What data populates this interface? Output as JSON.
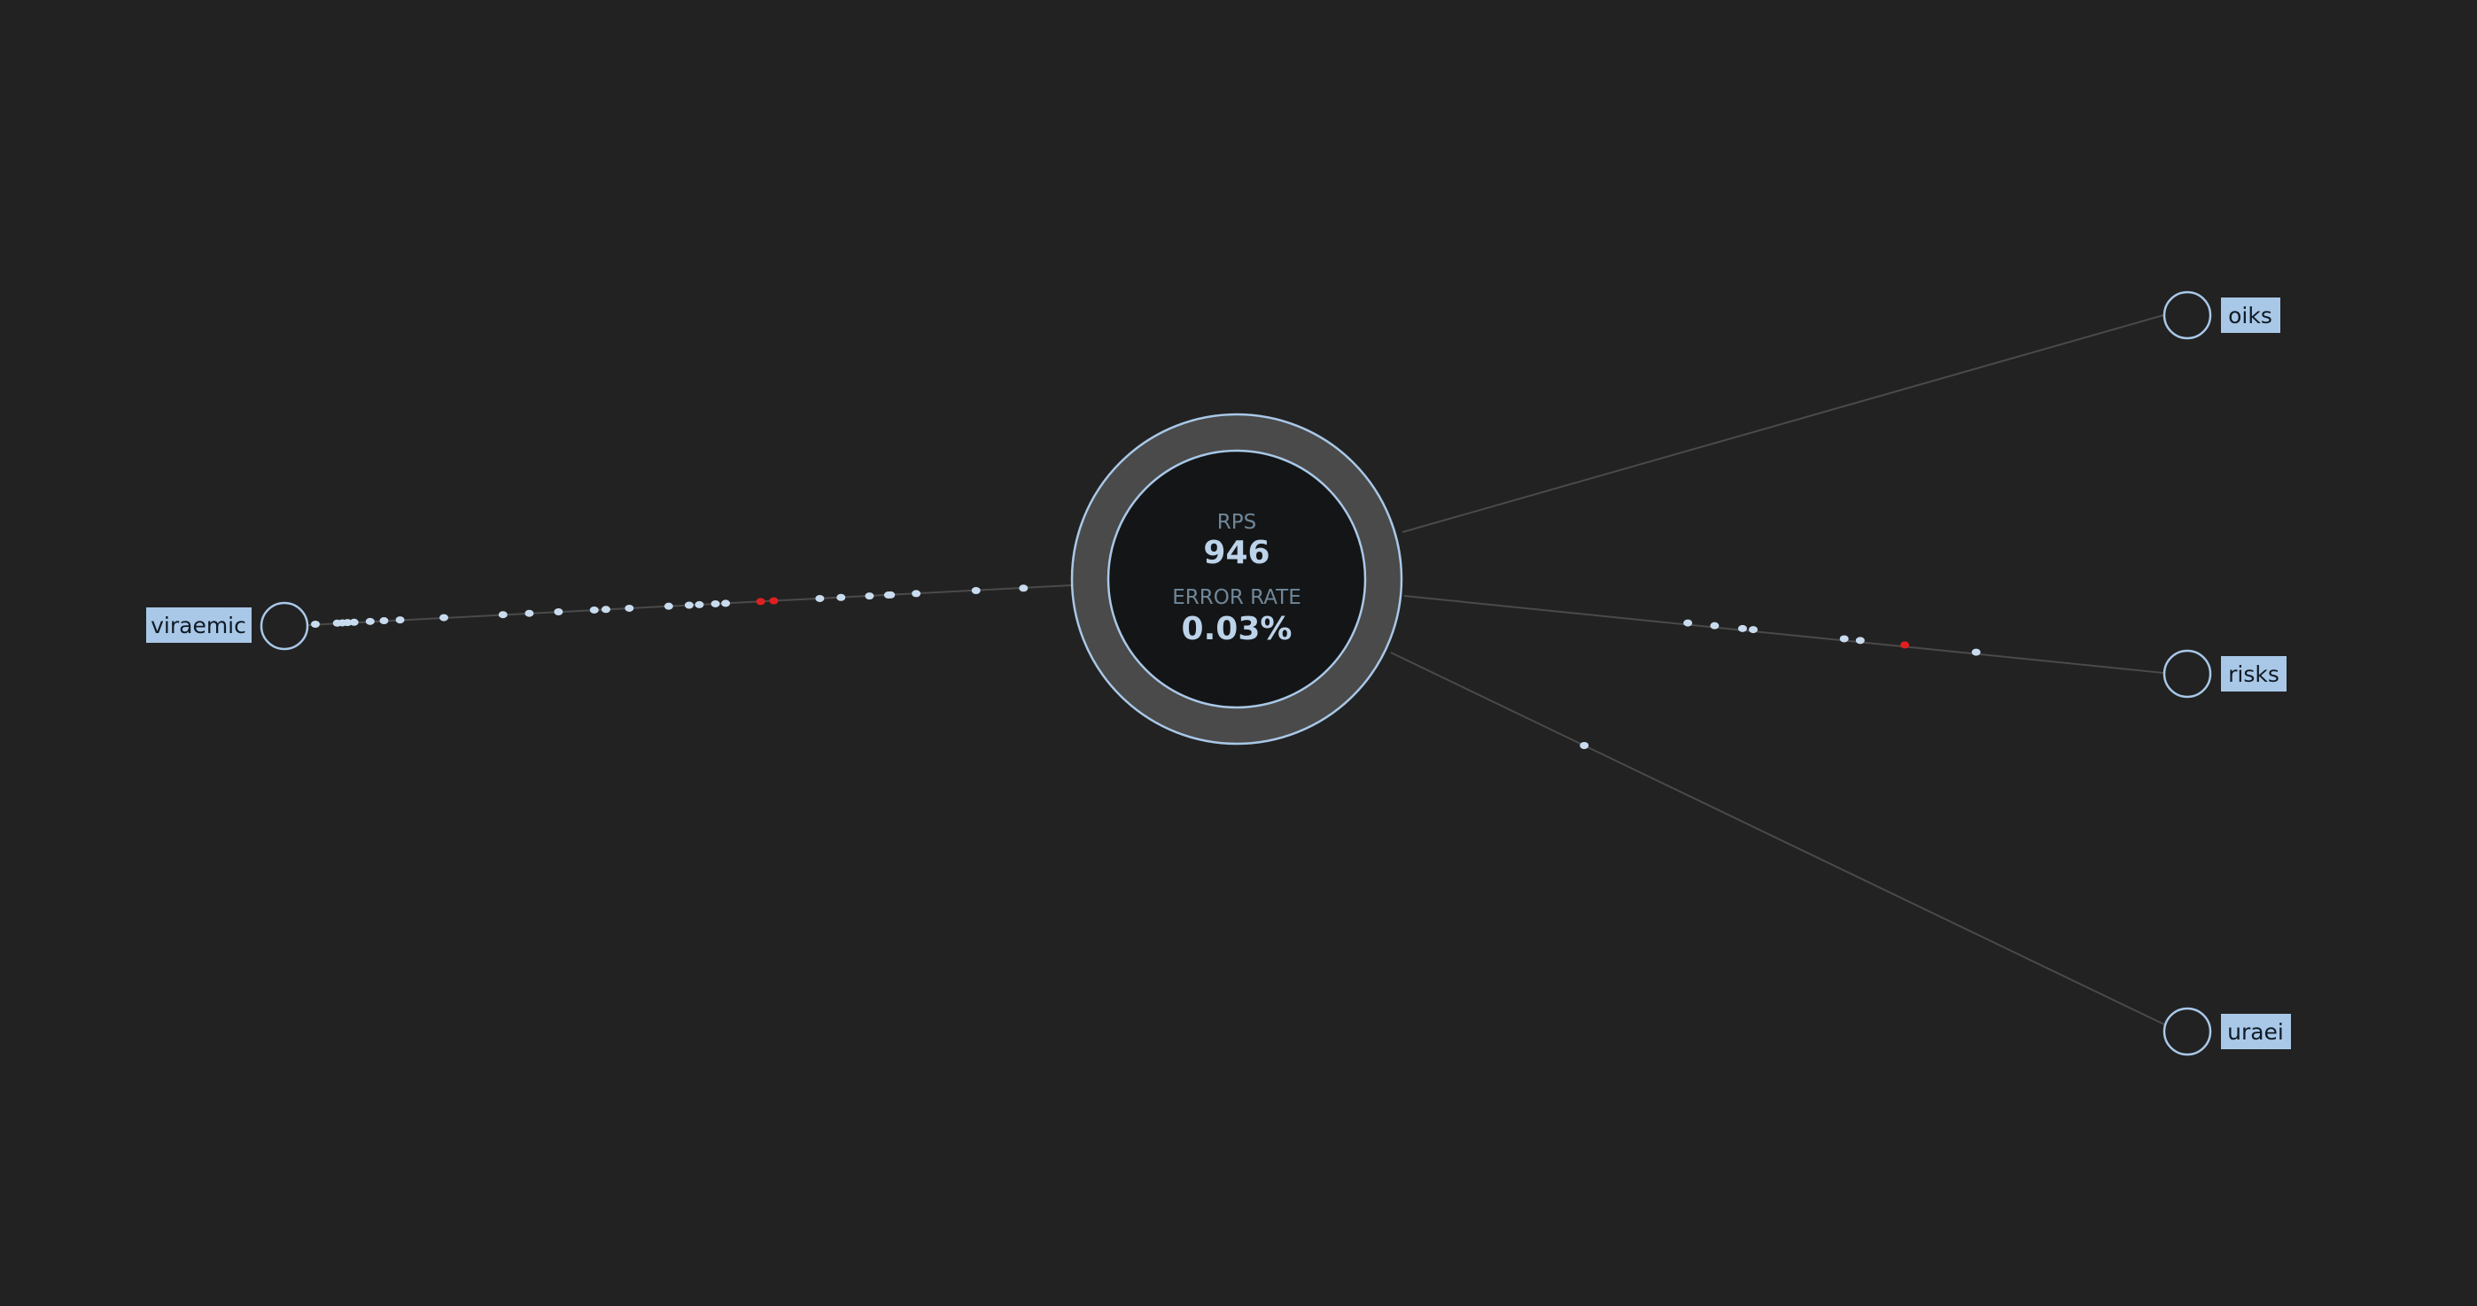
{
  "colors": {
    "background": "#222222",
    "accent": "#a9c8e8",
    "edge": "#4a4a4a",
    "ring": "#4a4a4a",
    "core": "#141516",
    "error_particle": "#e02020",
    "ok_particle": "#c9dcef"
  },
  "center": {
    "rps_label": "RPS",
    "rps_value": "946",
    "error_label": "ERROR RATE",
    "error_value": "0.03%"
  },
  "nodes": [
    {
      "name": "viraemic",
      "side": "left"
    },
    {
      "name": "oiks",
      "side": "right"
    },
    {
      "name": "risks",
      "side": "right"
    },
    {
      "name": "uraei",
      "side": "right"
    }
  ],
  "traffic": {
    "viraemic": {
      "ok_particles": [
        0.0,
        0.03,
        0.037,
        0.044,
        0.053,
        0.075,
        0.094,
        0.116,
        0.176,
        0.257,
        0.293,
        0.333,
        0.382,
        0.398,
        0.43,
        0.484,
        0.512,
        0.526,
        0.548,
        0.562,
        0.691,
        0.72,
        0.759,
        0.785,
        0.788,
        0.823,
        0.905,
        0.97
      ],
      "error_particles": [
        0.61,
        0.628
      ]
    },
    "risks": {
      "ok_particles": [
        0.2,
        0.245,
        0.292,
        0.31,
        0.463,
        0.49,
        0.685
      ],
      "error_particles": [
        0.565
      ]
    },
    "oiks": {
      "ok_particles": [],
      "error_particles": []
    },
    "uraei": {
      "ok_particles": [
        0.25
      ],
      "error_particles": []
    }
  }
}
